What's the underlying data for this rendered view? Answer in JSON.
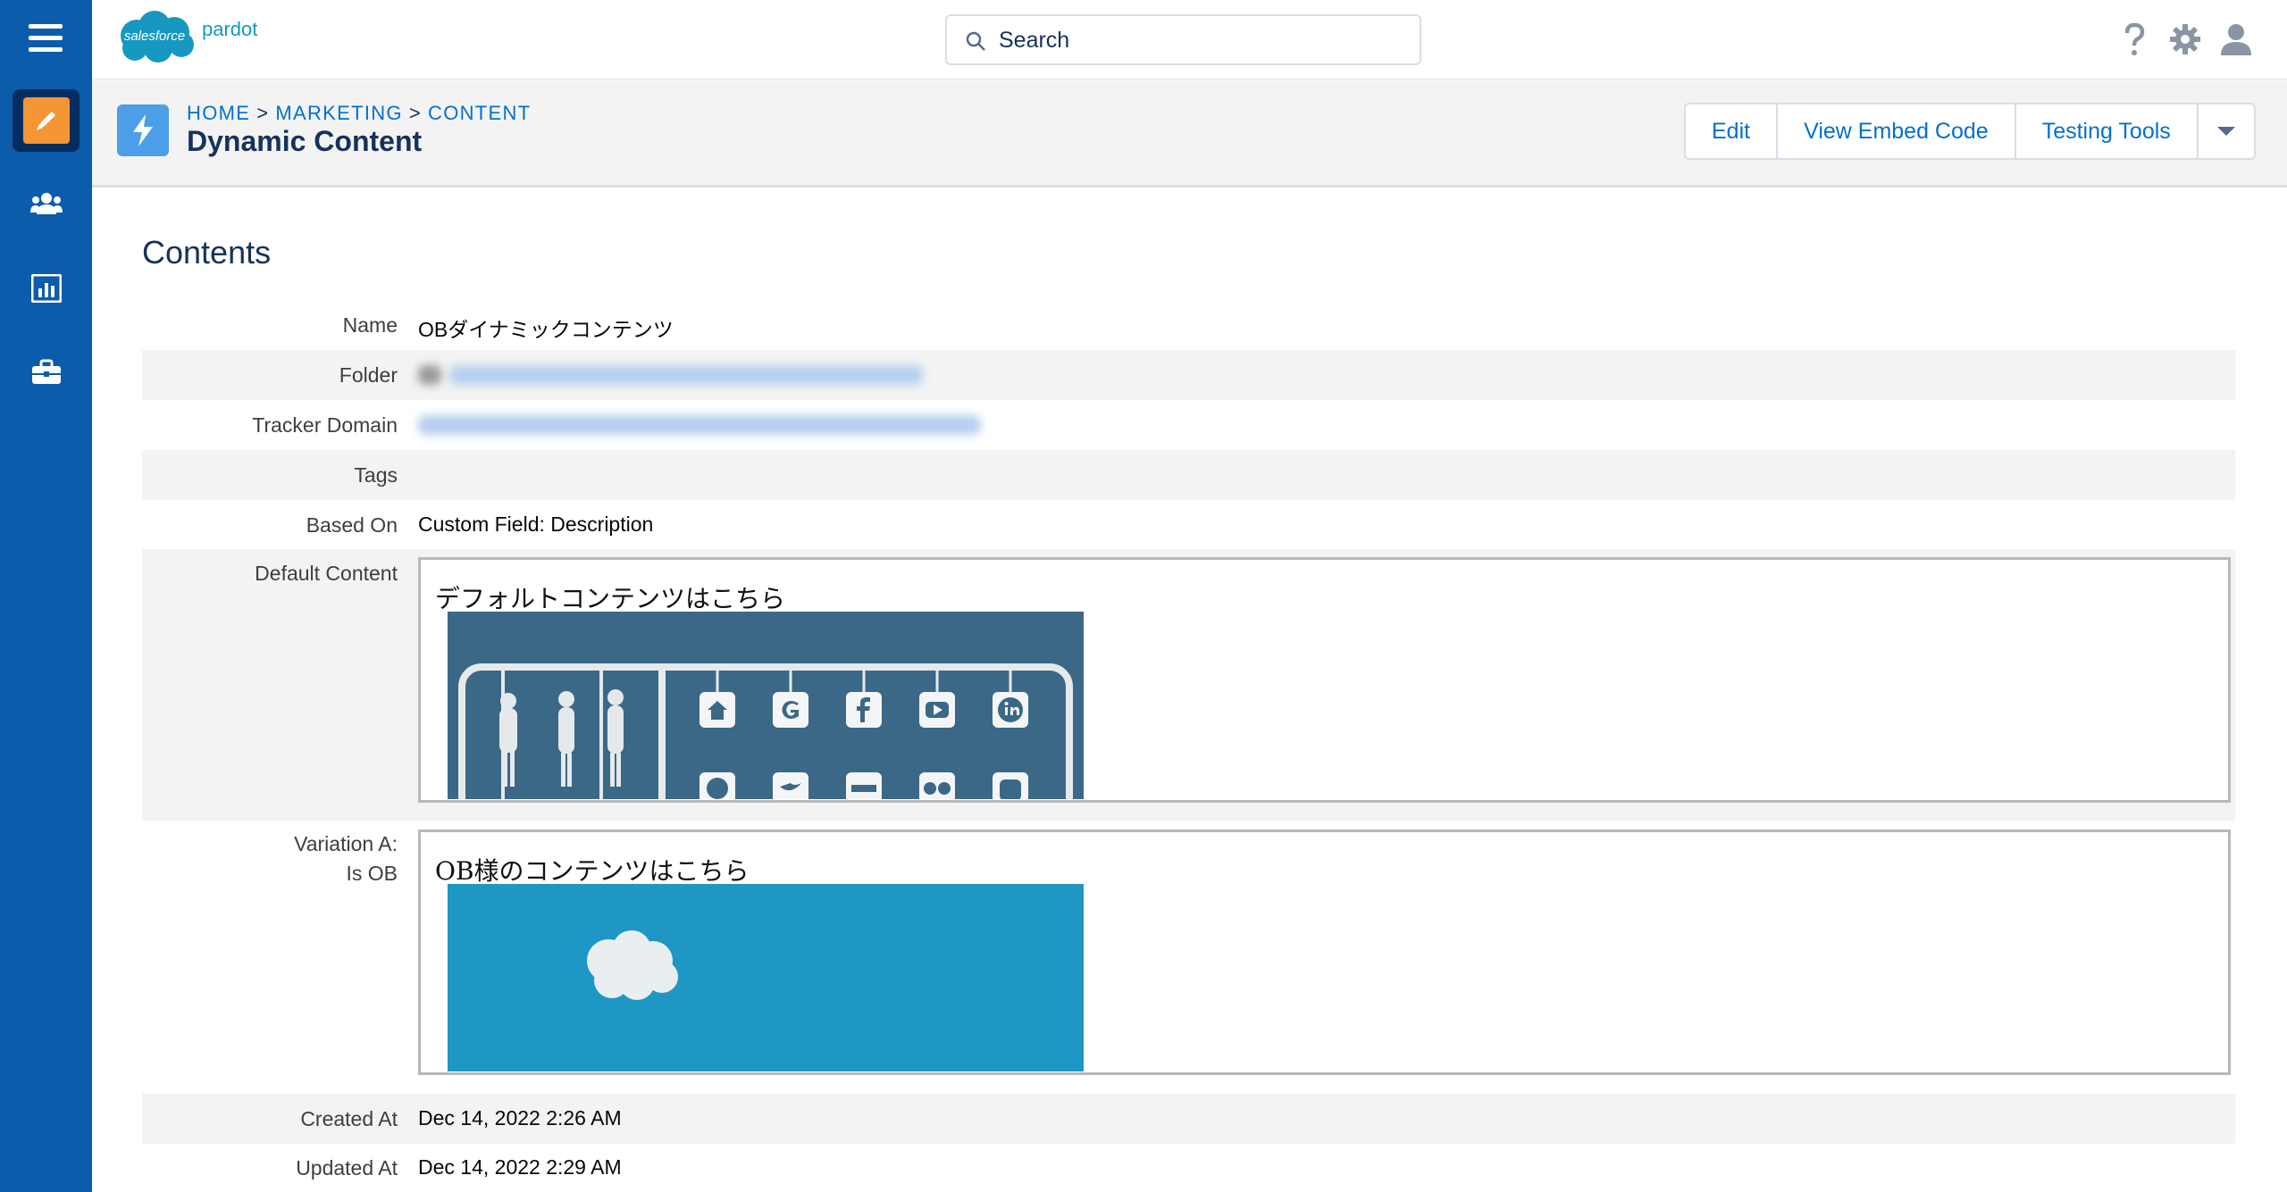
{
  "header": {
    "logo_main": "salesforce",
    "logo_sub": "pardot",
    "search_placeholder": "Search",
    "icons": [
      "help-icon",
      "gear-icon",
      "user-icon"
    ]
  },
  "nav": {
    "items": [
      {
        "name": "marketing",
        "icon": "pencil-icon",
        "active": true
      },
      {
        "name": "prospects",
        "icon": "people-icon",
        "active": false
      },
      {
        "name": "reports",
        "icon": "bar-chart-icon",
        "active": false
      },
      {
        "name": "admin",
        "icon": "briefcase-icon",
        "active": false
      }
    ]
  },
  "page": {
    "breadcrumb": [
      "HOME",
      "MARKETING",
      "CONTENT"
    ],
    "breadcrumb_sep": ">",
    "title": "Dynamic Content",
    "actions": {
      "edit": "Edit",
      "embed": "View Embed Code",
      "testing": "Testing Tools"
    }
  },
  "contents": {
    "section_title": "Contents",
    "labels": {
      "name": "Name",
      "folder": "Folder",
      "tracker_domain": "Tracker Domain",
      "tags": "Tags",
      "based_on": "Based On",
      "default_content": "Default Content",
      "variation_a_line1": "Variation A:",
      "variation_a_line2": "Is OB",
      "created_at": "Created At",
      "updated_at": "Updated At"
    },
    "values": {
      "name": "OBダイナミックコンテンツ",
      "based_on": "Custom Field: Description",
      "default_content_text": "デフォルトコンテンツはこちら",
      "variation_a_text": "OB様のコンテンツはこちら",
      "created_at": "Dec 14, 2022 2:26 AM",
      "updated_at": "Dec 14, 2022 2:29 AM"
    },
    "default_image_icons": [
      "home-icon",
      "google-icon",
      "facebook-icon",
      "youtube-icon",
      "linkedin-icon",
      "line-icon",
      "twitter-icon",
      "yahoo-icon",
      "infinity-icon",
      "instagram-icon"
    ],
    "variation_image_icon": "cloud-icon"
  },
  "colors": {
    "nav_bg": "#0b5cab",
    "active_tile": "#f49634",
    "link": "#0070d2",
    "default_image_bg": "#3b6886",
    "variation_image_bg": "#1f97c4"
  }
}
